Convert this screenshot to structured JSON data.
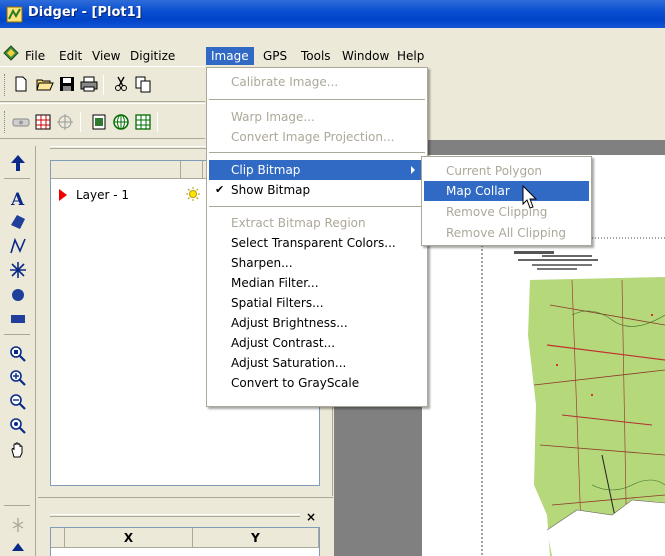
{
  "window": {
    "title": "Didger - [Plot1]"
  },
  "menubar": {
    "items": [
      {
        "label": "File"
      },
      {
        "label": "Edit"
      },
      {
        "label": "View"
      },
      {
        "label": "Digitize"
      },
      {
        "label": "Image"
      },
      {
        "label": "GPS"
      },
      {
        "label": "Tools"
      },
      {
        "label": "Window"
      },
      {
        "label": "Help"
      }
    ]
  },
  "image_menu": {
    "items": [
      {
        "label": "Calibrate Image...",
        "disabled": true
      },
      {
        "label": "Warp Image...",
        "disabled": true
      },
      {
        "label": "Convert Image Projection...",
        "disabled": true
      },
      {
        "label": "Clip Bitmap",
        "highlighted": true,
        "submenu": true
      },
      {
        "label": "Show Bitmap",
        "checked": true
      },
      {
        "label": "Extract Bitmap Region",
        "disabled": true
      },
      {
        "label": "Select Transparent Colors..."
      },
      {
        "label": "Sharpen..."
      },
      {
        "label": "Median Filter..."
      },
      {
        "label": "Spatial Filters..."
      },
      {
        "label": "Adjust Brightness..."
      },
      {
        "label": "Adjust Contrast..."
      },
      {
        "label": "Adjust Saturation..."
      },
      {
        "label": "Convert to GrayScale"
      }
    ]
  },
  "clip_submenu": {
    "items": [
      {
        "label": "Current Polygon",
        "disabled": true
      },
      {
        "label": "Map Collar",
        "highlighted": true
      },
      {
        "label": "Remove Clipping",
        "disabled": true
      },
      {
        "label": "Remove All Clipping",
        "disabled": true
      }
    ]
  },
  "layer_panel": {
    "layer_name": "Layer - 1"
  },
  "coord_panel": {
    "close": "×",
    "col_x": "X",
    "col_y": "Y"
  },
  "colors": {
    "accent": "#316ac5",
    "title_bar": "#0a4fd3",
    "menu_bg": "#ece9d8",
    "map_green": "#b5d87a"
  }
}
